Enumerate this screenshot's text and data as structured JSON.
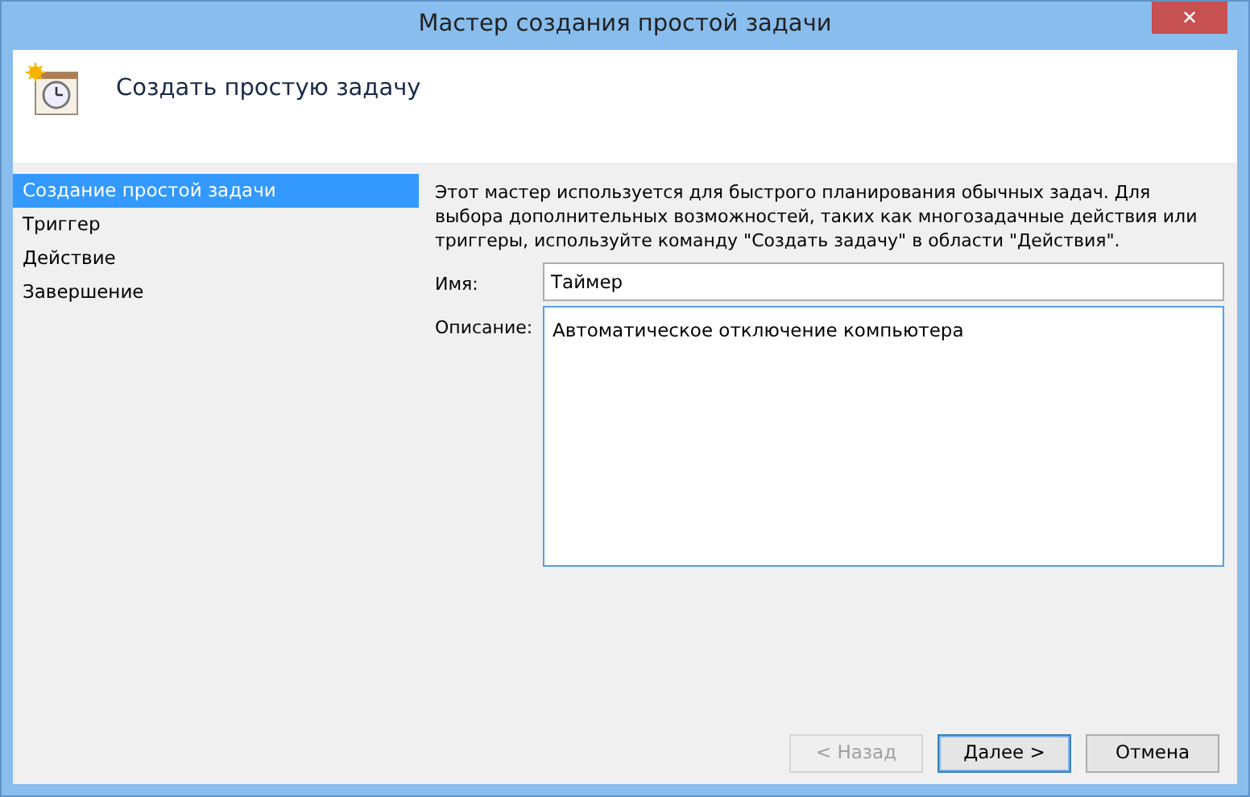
{
  "window": {
    "title": "Мастер создания простой задачи",
    "close": "✕"
  },
  "header": {
    "title": "Создать простую задачу"
  },
  "steps": [
    {
      "label": "Создание простой задачи",
      "selected": true
    },
    {
      "label": "Триггер",
      "selected": false
    },
    {
      "label": "Действие",
      "selected": false
    },
    {
      "label": "Завершение",
      "selected": false
    }
  ],
  "intro": "Этот мастер используется для быстрого планирования обычных задач.  Для выбора дополнительных возможностей, таких как многозадачные действия или триггеры, используйте команду \"Создать задачу\" в области \"Действия\".",
  "name_field": {
    "label": "Имя:",
    "value": "Таймер"
  },
  "description_field": {
    "label": "Описание:",
    "value": "Автоматическое отключение компьютера"
  },
  "buttons": [
    {
      "label": "< Назад",
      "disabled": true,
      "default": false
    },
    {
      "label": "Далее >",
      "disabled": false,
      "default": true
    },
    {
      "label": "Отмена",
      "disabled": false,
      "default": false
    }
  ]
}
